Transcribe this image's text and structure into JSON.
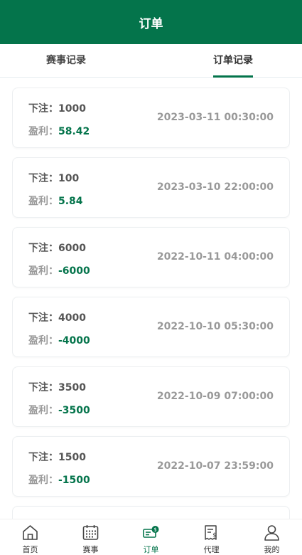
{
  "header": {
    "title": "订单"
  },
  "tabs": [
    {
      "label": "赛事记录",
      "active": false
    },
    {
      "label": "订单记录",
      "active": true
    }
  ],
  "orders": [
    {
      "bet_label": "下注：",
      "bet": "1000",
      "profit_label": "盈利：",
      "profit": "58.42",
      "time": "2023-03-11 00:30:00"
    },
    {
      "bet_label": "下注：",
      "bet": "100",
      "profit_label": "盈利：",
      "profit": "5.84",
      "time": "2023-03-10 22:00:00"
    },
    {
      "bet_label": "下注：",
      "bet": "6000",
      "profit_label": "盈利：",
      "profit": "-6000",
      "time": "2022-10-11 04:00:00"
    },
    {
      "bet_label": "下注：",
      "bet": "4000",
      "profit_label": "盈利：",
      "profit": "-4000",
      "time": "2022-10-10 05:30:00"
    },
    {
      "bet_label": "下注：",
      "bet": "3500",
      "profit_label": "盈利：",
      "profit": "-3500",
      "time": "2022-10-09 07:00:00"
    },
    {
      "bet_label": "下注：",
      "bet": "1500",
      "profit_label": "盈利：",
      "profit": "-1500",
      "time": "2022-10-07 23:59:00"
    }
  ],
  "nav": [
    {
      "label": "首页",
      "icon": "home-icon",
      "active": false
    },
    {
      "label": "赛事",
      "icon": "calendar-icon",
      "active": false
    },
    {
      "label": "订单",
      "icon": "order-icon",
      "active": true
    },
    {
      "label": "代理",
      "icon": "agent-icon",
      "active": false
    },
    {
      "label": "我的",
      "icon": "user-icon",
      "active": false
    }
  ],
  "colors": {
    "brand": "#04744b",
    "muted": "#999999"
  }
}
